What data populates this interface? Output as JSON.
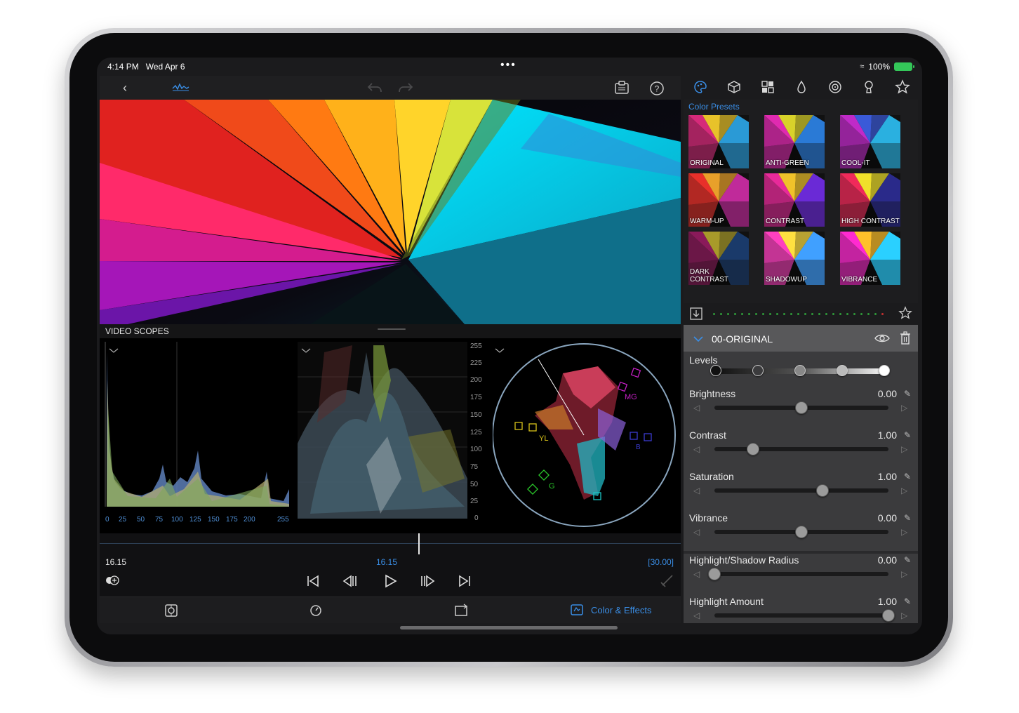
{
  "status": {
    "time": "4:14 PM",
    "date": "Wed Apr 6",
    "battery": "100%",
    "more": "•••"
  },
  "toolbar": {
    "back_icon": "chevron-left-icon",
    "waveform_icon": "waveform-icon",
    "undo_icon": "undo-icon",
    "redo_icon": "redo-icon",
    "clipboard_icon": "clipboard-icon",
    "help_icon": "help-icon",
    "help_glyph": "?"
  },
  "scopes": {
    "title": "VIDEO SCOPES",
    "histogram_ticks": [
      "0",
      "25",
      "50",
      "75",
      "100",
      "125",
      "150",
      "175",
      "200",
      "255"
    ],
    "waveform_ticks": [
      "255",
      "225",
      "200",
      "175",
      "150",
      "125",
      "100",
      "75",
      "50",
      "25",
      "0"
    ],
    "vectorscope_labels": {
      "mg": "MG",
      "yl": "YL",
      "g": "G",
      "b": "B"
    }
  },
  "timeline": {
    "current_time_left": "16.15",
    "current_time_center": "16.15",
    "duration": "[30.00]",
    "progress": 0.5
  },
  "tabs": {
    "active_label": "Color & Effects"
  },
  "right_panel": {
    "icons": [
      "palette-icon",
      "cube-icon",
      "grid-icon",
      "drop-icon",
      "target-icon",
      "keyhole-icon",
      "star-icon"
    ],
    "presets_title": "Color Presets",
    "presets": [
      "ORIGINAL",
      "ANTI-GREEN",
      "COOL-IT",
      "WARM-UP",
      "CONTRAST",
      "HIGH CONTRAST",
      "DARK CONTRAST",
      "SHADOWUP",
      "VIBRANCE"
    ],
    "adjustment_title": "00-ORIGINAL",
    "levels_label": "Levels",
    "controls": [
      {
        "label": "Brightness",
        "value": "0.00",
        "level": 0.5
      },
      {
        "label": "Contrast",
        "value": "1.00",
        "level": 0.22
      },
      {
        "label": "Saturation",
        "value": "1.00",
        "level": 0.62
      },
      {
        "label": "Vibrance",
        "value": "0.00",
        "level": 0.5
      },
      {
        "label": "Highlight/Shadow Radius",
        "value": "0.00",
        "level": 0.0
      },
      {
        "label": "Highlight Amount",
        "value": "1.00",
        "level": 1.0
      }
    ]
  },
  "colors": {
    "accent": "#3a8ee6",
    "background": "#1b1b1d",
    "panel": "#3b3b3d"
  }
}
